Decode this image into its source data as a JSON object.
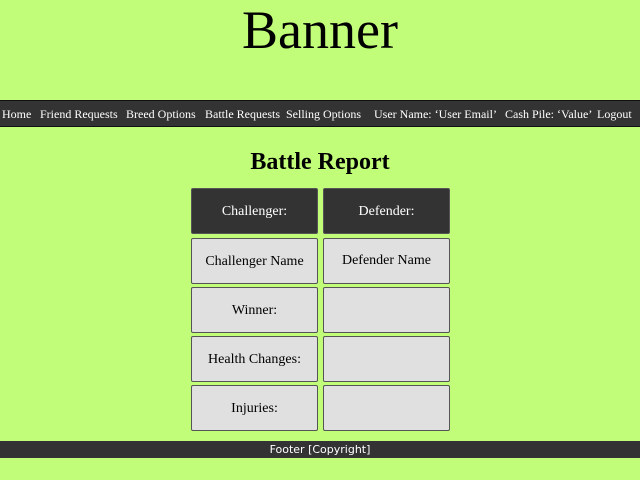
{
  "banner": {
    "title": "Banner"
  },
  "nav": {
    "home": "Home",
    "friend_requests": "Friend Requests",
    "breed_options": "Breed Options",
    "battle_requests": "Battle Requests",
    "selling_options": "Selling Options",
    "user_name": "User Name: ‘User Email’",
    "cash_pile": "Cash Pile: ‘Value’",
    "logout": "Logout"
  },
  "page": {
    "title": "Battle Report"
  },
  "report": {
    "headers": {
      "challenger": "Challenger:",
      "defender": "Defender:"
    },
    "challenger_name": "Challenger Name",
    "defender_name": "Defender Name",
    "winner_label": "Winner:",
    "winner_value": "",
    "health_changes_label": "Health Changes:",
    "health_changes_value": "",
    "injuries_label": "Injuries:",
    "injuries_value": ""
  },
  "footer": {
    "text": "Footer [Copyright]"
  },
  "colors": {
    "background": "#c1fd78",
    "bar": "#333333",
    "cell": "#e0e0e0"
  }
}
